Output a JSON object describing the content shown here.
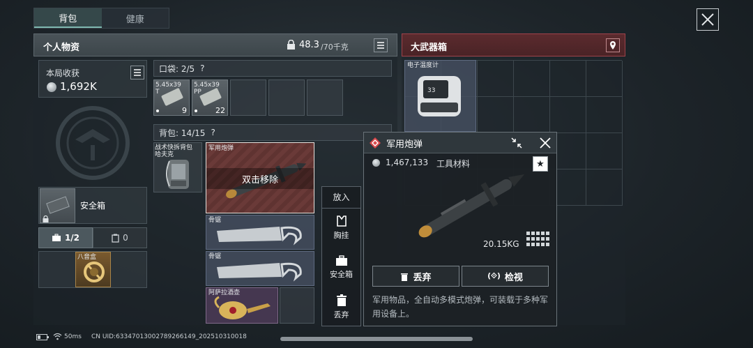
{
  "tabs": [
    {
      "label": "背包"
    },
    {
      "label": "健康"
    }
  ],
  "personal": {
    "title": "个人物资",
    "weight_value": "48.3",
    "weight_limit": "/70千克",
    "earnings_label": "本局收获",
    "earnings_value": "1,692K",
    "safebox_label": "安全箱",
    "tab_case": "1/2",
    "tab_other": "0",
    "badge_item": "八音盒"
  },
  "pockets": {
    "label": "口袋: 2/5",
    "help": "?",
    "items": [
      {
        "name": "5.45x39",
        "sub": "T",
        "count": "9"
      },
      {
        "name": "5.45x39",
        "sub": "PP",
        "count": "22"
      }
    ]
  },
  "backpack": {
    "label": "背包: 14/15",
    "help": "?",
    "bag_item": "战术快拆背包",
    "bag_item2": "哈夫克",
    "selected_item": "军用炮弹",
    "remove_hint": "双击移除",
    "bone_saw_1": "骨锯",
    "bone_saw_2": "骨锯",
    "lamp": "阿萨拉酒壶"
  },
  "crate": {
    "title": "大武器箱",
    "thermometer": "电子温度计"
  },
  "popup": {
    "title": "军用炮弹",
    "price": "1,467,133",
    "category": "工具材料",
    "weight": "20.15KG",
    "discard": "丢弃",
    "inspect": "检视",
    "description": "军用物品，全自动多模式炮弹，可装载于多种军用设备上。"
  },
  "side_menu": {
    "title": "放入",
    "items": [
      {
        "label": "胸挂"
      },
      {
        "label": "安全箱"
      },
      {
        "label": "丢弃"
      }
    ]
  },
  "status": {
    "ping": "50ms",
    "uid": "CN UID:6334701300278926614​9_202510310018"
  },
  "colors": {
    "accent": "#7fb8b0",
    "crate_red": "#a0424a",
    "popup_icon": "#d9484b"
  }
}
